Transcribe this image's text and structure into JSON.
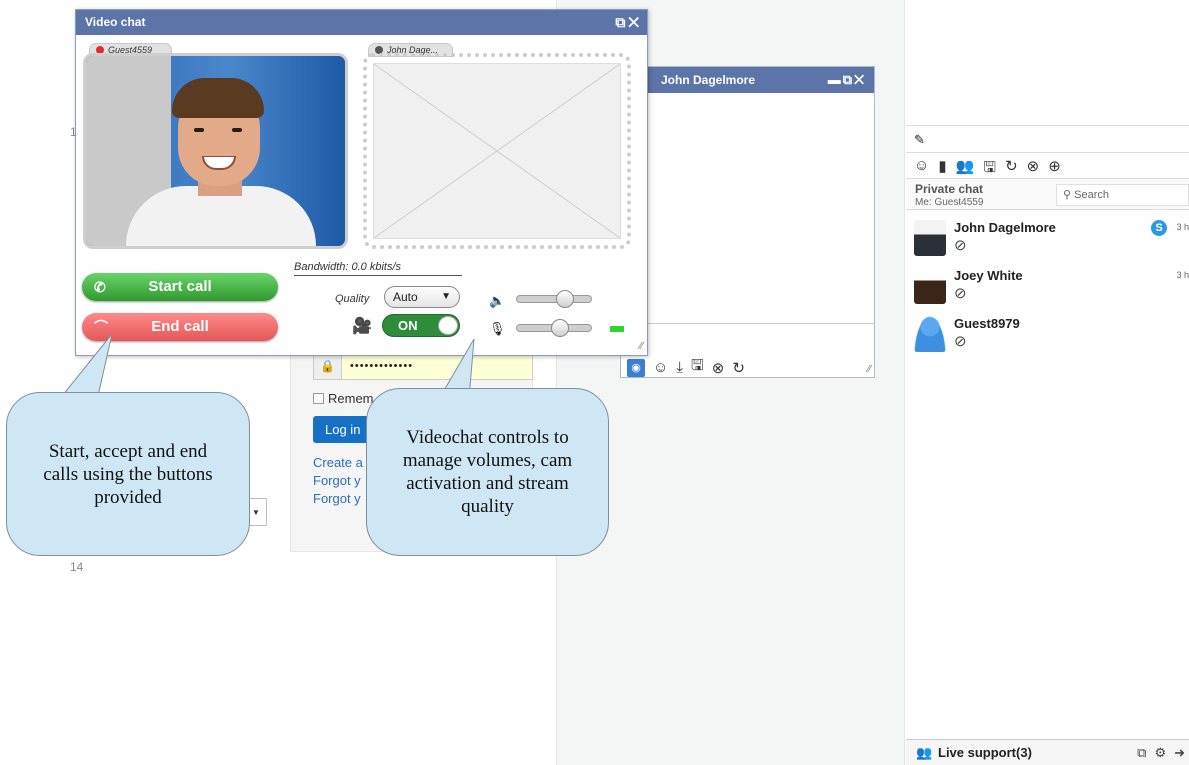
{
  "background": {
    "row_numbers": [
      "1",
      "14"
    ],
    "login": {
      "password_mask": "•••••••••••••",
      "remember_label": "Remem",
      "login_button": "Log in",
      "links": [
        "Create a",
        "Forgot y",
        "Forgot y"
      ]
    }
  },
  "video_chat": {
    "title": "Video chat",
    "controls": "⧉✕",
    "local_tab": "Guest4559",
    "remote_tab": "John Dage...",
    "bandwidth": "Bandwidth: 0.0 kbits/s",
    "start_call": "Start call",
    "end_call": "End call",
    "quality_label": "Quality",
    "quality_value": "Auto",
    "cam_toggle": "ON",
    "speaker_volume": 0.7,
    "mic_volume": 0.6,
    "colors": {
      "header": "#5c74a8",
      "start": "#3aa83a",
      "end": "#ef6b6b",
      "toggle": "#2e8c3a"
    }
  },
  "private_chat_window": {
    "title": "John Dagelmore",
    "controls": "▬⧉✕"
  },
  "sidebar": {
    "toolbar_icon": "pencil-icon",
    "icons": [
      "smiley-icon",
      "door-icon",
      "users-icon",
      "save-icon",
      "refresh-icon",
      "close-circle-icon",
      "plus-circle-icon"
    ],
    "private_title": "Private chat",
    "me_label": "Me: Guest4559",
    "search_placeholder": "Search",
    "users": [
      {
        "name": "John Dagelmore",
        "time": "3 h",
        "skype": true
      },
      {
        "name": "Joey White",
        "time": "3 h",
        "skype": false
      },
      {
        "name": "Guest8979",
        "time": "",
        "skype": false
      }
    ],
    "live_support": "Live support(3)"
  },
  "callouts": {
    "left": "Start, accept and end calls using the buttons provided",
    "right": "Videochat controls to manage volumes, cam activation and stream quality"
  }
}
